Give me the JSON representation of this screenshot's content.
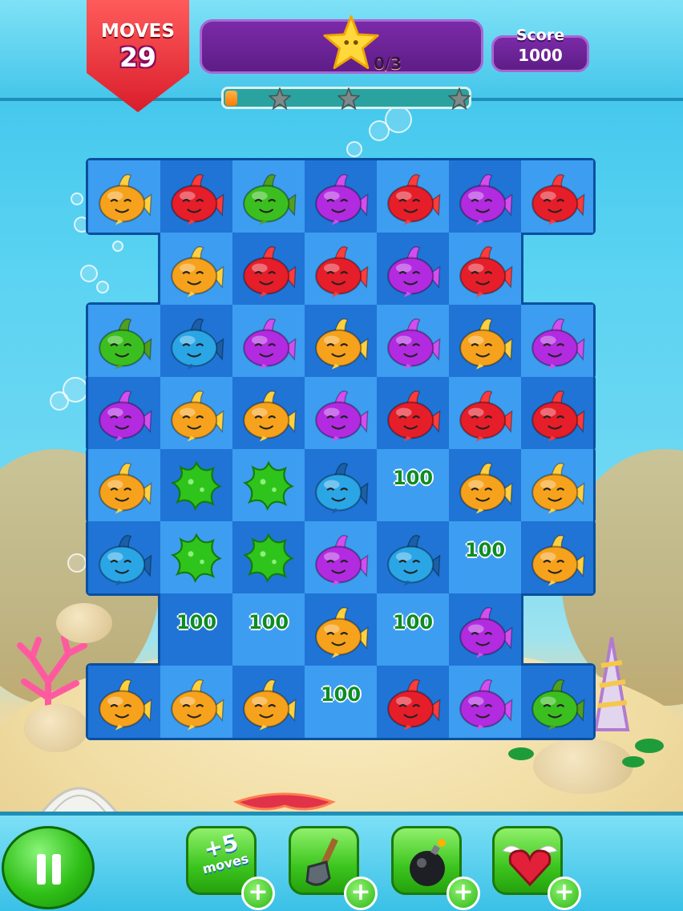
{
  "hud": {
    "moves_label": "MOVES",
    "moves_count": "29",
    "stars_progress": "0/3",
    "score_label": "Score",
    "score_value": "1000",
    "level_progress_fraction": 0.05
  },
  "colors": {
    "red": "#e51e2a",
    "orange": "#f6a21c",
    "green": "#3bbf20",
    "purple": "#b22be0",
    "blue": "#2aa6e6",
    "cell_dark": "#1f74d6",
    "cell_light": "#3d9df0"
  },
  "board": {
    "rows": [
      [
        "orange",
        "red",
        "green",
        "purple",
        "red",
        "purple",
        "red"
      ],
      [
        null,
        "orange",
        "red",
        "red",
        "purple",
        "red",
        null
      ],
      [
        "green",
        "blue",
        "purple",
        "orange",
        "purple",
        "orange",
        "purple"
      ],
      [
        "purple",
        "orange",
        "orange",
        "purple",
        "red",
        "red",
        "red"
      ],
      [
        "orange",
        "splat",
        "splat",
        "blue",
        "pts",
        "orange",
        "orange"
      ],
      [
        "blue",
        "splat",
        "splat",
        "purple",
        "blue",
        "pts",
        "orange"
      ],
      [
        null,
        "pts",
        "pts",
        "orange",
        "pts",
        "purple",
        null
      ],
      [
        "orange",
        "orange",
        "orange",
        "pts",
        "red",
        "purple",
        "green"
      ]
    ],
    "points_text": "100"
  },
  "boosters": [
    {
      "name": "extra-moves",
      "label_top": "+5",
      "label_bottom": "moves",
      "icon": "plus-five-moves-icon"
    },
    {
      "name": "shovel",
      "icon": "shovel-icon"
    },
    {
      "name": "bomb",
      "icon": "bomb-icon"
    },
    {
      "name": "winged-heart",
      "icon": "winged-heart-icon"
    }
  ],
  "booster_add_label": "+"
}
